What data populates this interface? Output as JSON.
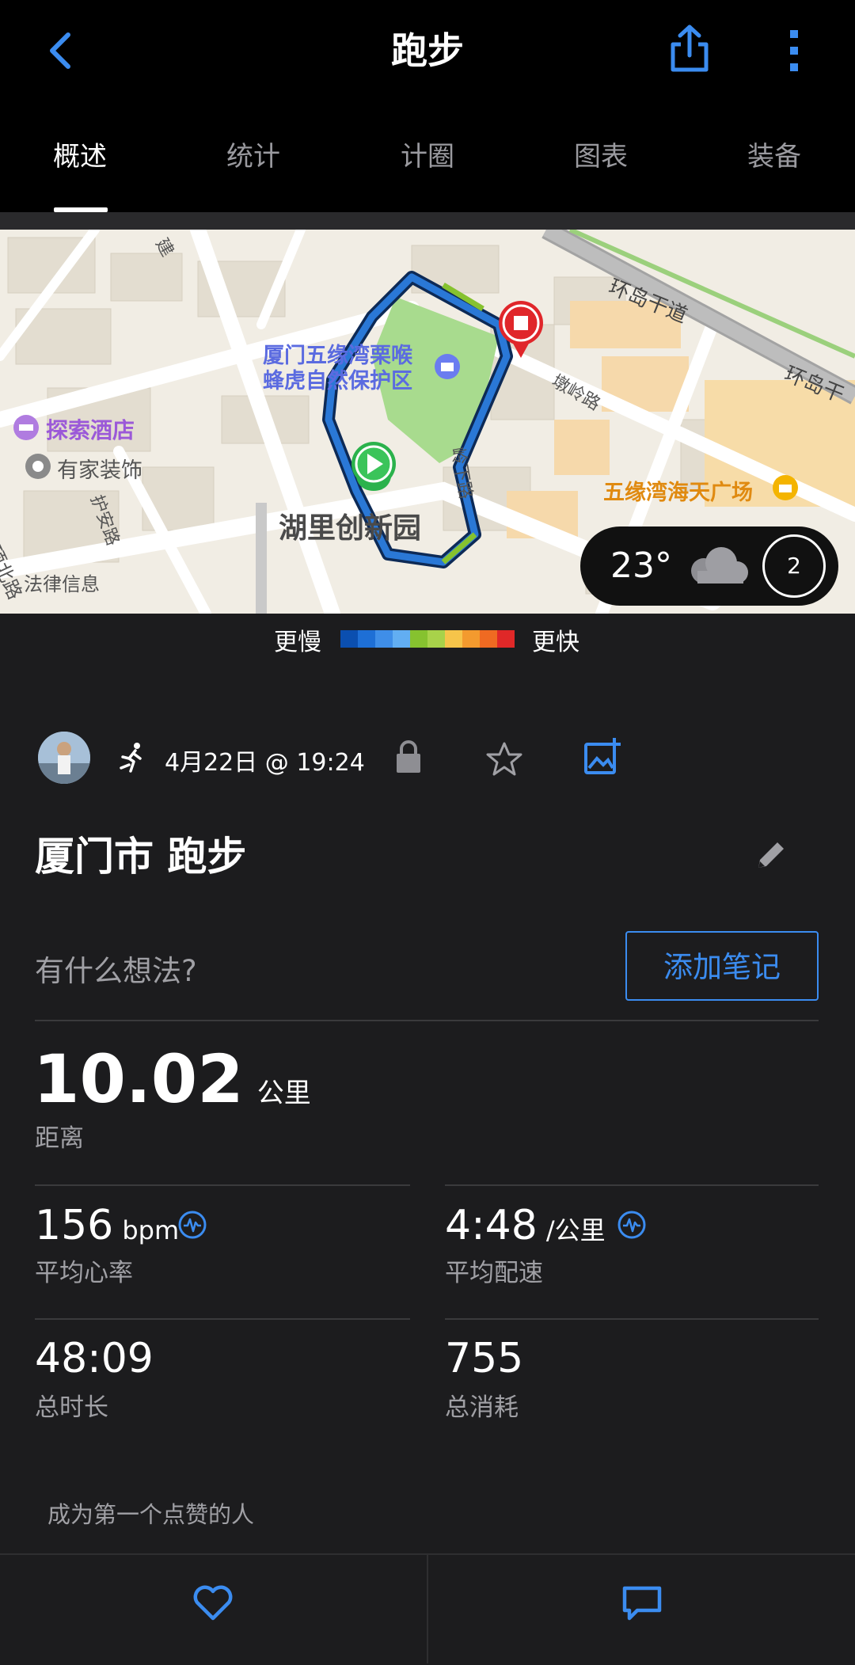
{
  "header": {
    "title": "跑步",
    "back_icon": "chevron-left-icon",
    "share_icon": "share-icon",
    "more_icon": "more-vertical-icon",
    "accent_color": "#3b8cf0"
  },
  "tabs": [
    {
      "label": "概述",
      "active": true
    },
    {
      "label": "统计",
      "active": false
    },
    {
      "label": "计圈",
      "active": false
    },
    {
      "label": "图表",
      "active": false
    },
    {
      "label": "装备",
      "active": false
    }
  ],
  "map": {
    "labels": {
      "reserve_line1": "厦门五缘湾栗喉",
      "reserve_line2": "蜂虎自然保护区",
      "hotel": "探索酒店",
      "decor": "有家装饰",
      "park": "湖里创新园",
      "plaza": "五缘湾海天广场",
      "road_huandao": "环岛干道",
      "road_huandao2": "环岛干",
      "road_dunling": "墩岭路",
      "road_huan": "护安路",
      "road_yunding": "云顶北路",
      "road_jian": "建",
      "road_ling": "岭下路",
      "legal": "法律信息"
    },
    "weather": {
      "temperature": "23°",
      "icon": "cloud-icon",
      "wind": "2"
    }
  },
  "pace_legend": {
    "slower": "更慢",
    "faster": "更快",
    "colors": [
      "#0b4fb0",
      "#1e6fd6",
      "#3f8ee8",
      "#62aef2",
      "#86c22f",
      "#a8d24a",
      "#f6c44a",
      "#f39a2e",
      "#ef6a22",
      "#e02828"
    ]
  },
  "activity": {
    "date": "4月22日 @ 19:24",
    "activity_icon": "running-icon",
    "privacy_icon": "lock-icon",
    "favorite_icon": "star-icon",
    "add_photo_icon": "add-photo-icon",
    "title": "厦门市 跑步",
    "edit_icon": "pencil-icon",
    "note_placeholder": "有什么想法?",
    "add_note_label": "添加笔记"
  },
  "metrics": {
    "distance": {
      "value": "10.02",
      "unit": "公里",
      "label": "距离"
    },
    "avg_hr": {
      "value": "156",
      "unit": "bpm",
      "label": "平均心率"
    },
    "avg_pace": {
      "value": "4:48",
      "unit": "/公里",
      "label": "平均配速"
    },
    "duration": {
      "value": "48:09",
      "label": "总时长"
    },
    "calories": {
      "value": "755",
      "label": "总消耗"
    }
  },
  "social": {
    "like_prompt": "成为第一个点赞的人",
    "like_icon": "heart-icon",
    "comment_icon": "comment-icon"
  }
}
